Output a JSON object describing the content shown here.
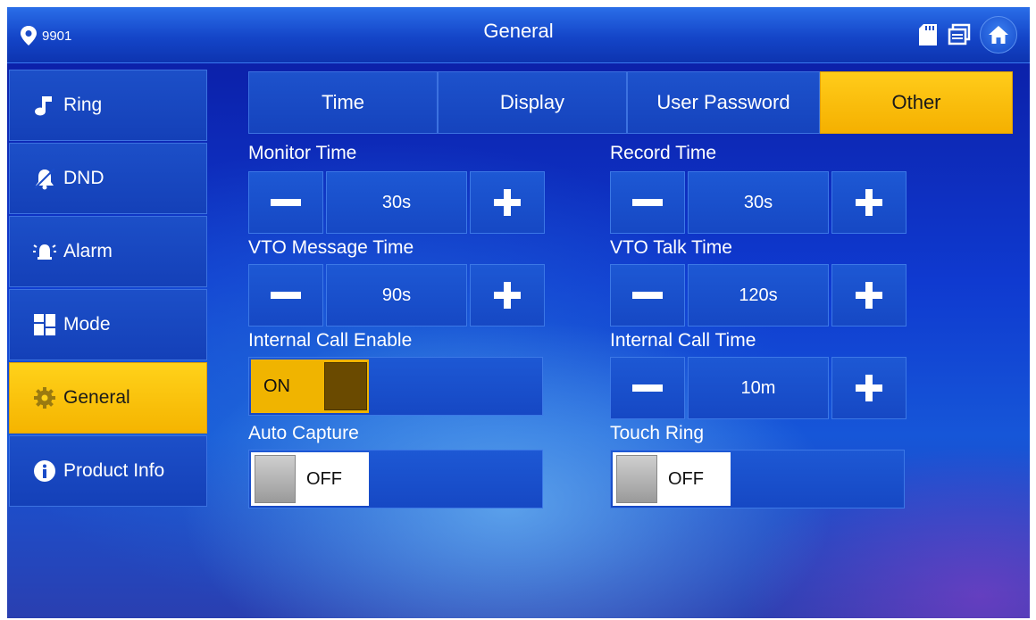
{
  "header": {
    "location_id": "9901",
    "title": "General"
  },
  "sidebar": {
    "items": [
      {
        "label": "Ring",
        "icon": "music-note-icon",
        "active": false
      },
      {
        "label": "DND",
        "icon": "bell-mute-icon",
        "active": false
      },
      {
        "label": "Alarm",
        "icon": "alarm-icon",
        "active": false
      },
      {
        "label": "Mode",
        "icon": "mode-grid-icon",
        "active": false
      },
      {
        "label": "General",
        "icon": "gear-icon",
        "active": true
      },
      {
        "label": "Product Info",
        "icon": "info-icon",
        "active": false
      }
    ]
  },
  "tabs": [
    {
      "label": "Time",
      "active": false
    },
    {
      "label": "Display",
      "active": false
    },
    {
      "label": "User Password",
      "active": false
    },
    {
      "label": "Other",
      "active": true
    }
  ],
  "settings": {
    "monitor_time": {
      "label": "Monitor Time",
      "value": "30s"
    },
    "record_time": {
      "label": "Record Time",
      "value": "30s"
    },
    "vto_message_time": {
      "label": "VTO Message Time",
      "value": "90s"
    },
    "vto_talk_time": {
      "label": "VTO Talk Time",
      "value": "120s"
    },
    "internal_call_enable": {
      "label": "Internal Call Enable",
      "state": "ON"
    },
    "internal_call_time": {
      "label": "Internal Call Time",
      "value": "10m"
    },
    "auto_capture": {
      "label": "Auto Capture",
      "state": "OFF"
    },
    "touch_ring": {
      "label": "Touch Ring",
      "state": "OFF"
    }
  },
  "colors": {
    "accent": "#f5b400",
    "panel": "#1648c4",
    "background": "#0f3ad0"
  }
}
